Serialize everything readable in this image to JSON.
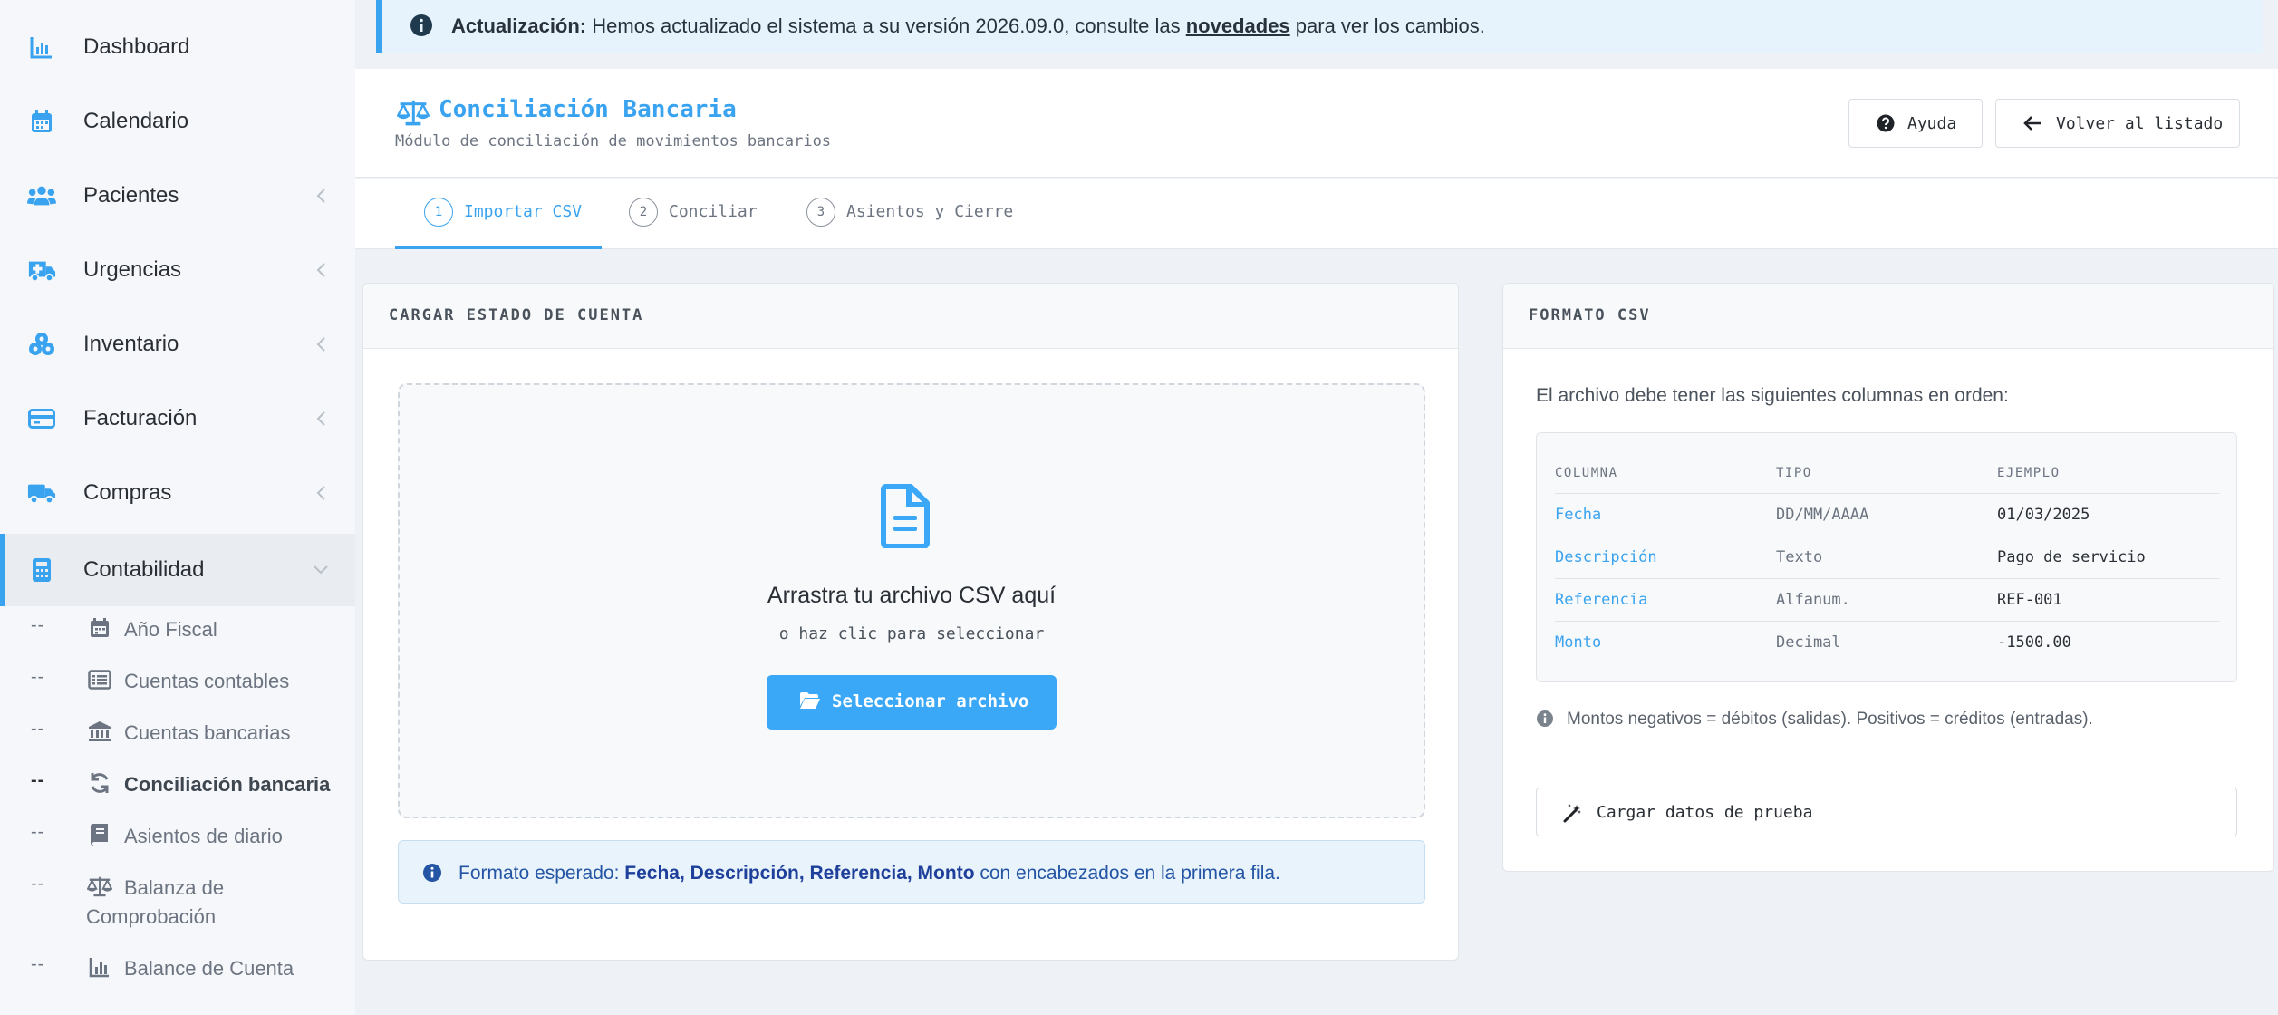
{
  "colors": {
    "accent": "#3aa3f0",
    "sidebar_bg": "#f5f7fa",
    "page_bg": "#eef1f6",
    "info_text": "#2455a4"
  },
  "sidebar": {
    "items": [
      {
        "label": "Dashboard",
        "icon": "chart-bar-icon",
        "has_chevron": false
      },
      {
        "label": "Calendario",
        "icon": "calendar-icon",
        "has_chevron": false
      },
      {
        "label": "Pacientes",
        "icon": "users-icon",
        "has_chevron": true
      },
      {
        "label": "Urgencias",
        "icon": "ambulance-icon",
        "has_chevron": true
      },
      {
        "label": "Inventario",
        "icon": "boxes-icon",
        "has_chevron": true
      },
      {
        "label": "Facturación",
        "icon": "credit-card-icon",
        "has_chevron": true
      },
      {
        "label": "Compras",
        "icon": "truck-icon",
        "has_chevron": true
      },
      {
        "label": "Contabilidad",
        "icon": "calculator-icon",
        "has_chevron": true,
        "expanded": true
      }
    ],
    "subitems": [
      {
        "prefix": "--",
        "label": "Año Fiscal",
        "icon": "calendar-icon"
      },
      {
        "prefix": "--",
        "label": "Cuentas contables",
        "icon": "list-alt-icon"
      },
      {
        "prefix": "--",
        "label": "Cuentas bancarias",
        "icon": "bank-icon"
      },
      {
        "prefix": "--",
        "label": "Conciliación bancaria",
        "icon": "sync-icon",
        "active": true
      },
      {
        "prefix": "--",
        "label": "Asientos de diario",
        "icon": "book-icon"
      },
      {
        "prefix": "--",
        "label_line1": "Balanza de",
        "label_line2": "Comprobación",
        "icon": "balance-scale-icon"
      },
      {
        "prefix": "--",
        "label": "Balance de Cuenta",
        "icon": "chart-bar-icon"
      }
    ]
  },
  "alert": {
    "icon": "info-circle-icon",
    "strong": "Actualización:",
    "text_before_link": " Hemos actualizado el sistema a su versión 2026.09.0, consulte las ",
    "link": "novedades",
    "text_after_link": " para ver los cambios."
  },
  "header": {
    "icon": "balance-scale-icon",
    "title": "Conciliación Bancaria",
    "subtitle": "Módulo de conciliación de movimientos bancarios",
    "help_label": "Ayuda",
    "back_label": "Volver al listado"
  },
  "tabs": [
    {
      "num": "1",
      "label": "Importar CSV",
      "active": true
    },
    {
      "num": "2",
      "label": "Conciliar",
      "active": false
    },
    {
      "num": "3",
      "label": "Asientos y Cierre",
      "active": false
    }
  ],
  "upload": {
    "card_title": "CARGAR ESTADO DE CUENTA",
    "dropzone_title": "Arrastra tu archivo CSV aquí",
    "dropzone_sub": "o haz clic para seleccionar",
    "button_label": "Seleccionar archivo",
    "info_prefix": "Formato esperado: ",
    "info_bold": "Fecha, Descripción, Referencia, Monto",
    "info_suffix": " con encabezados en la primera fila."
  },
  "format": {
    "card_title": "FORMATO CSV",
    "description": "El archivo debe tener las siguientes columnas en orden:",
    "headers": [
      "COLUMNA",
      "TIPO",
      "EJEMPLO"
    ],
    "rows": [
      [
        "Fecha",
        "DD/MM/AAAA",
        "01/03/2025"
      ],
      [
        "Descripción",
        "Texto",
        "Pago de servicio"
      ],
      [
        "Referencia",
        "Alfanum.",
        "REF-001"
      ],
      [
        "Monto",
        "Decimal",
        "-1500.00"
      ]
    ],
    "note": "Montos negativos = débitos (salidas). Positivos = créditos (entradas).",
    "test_button": "Cargar datos de prueba"
  }
}
